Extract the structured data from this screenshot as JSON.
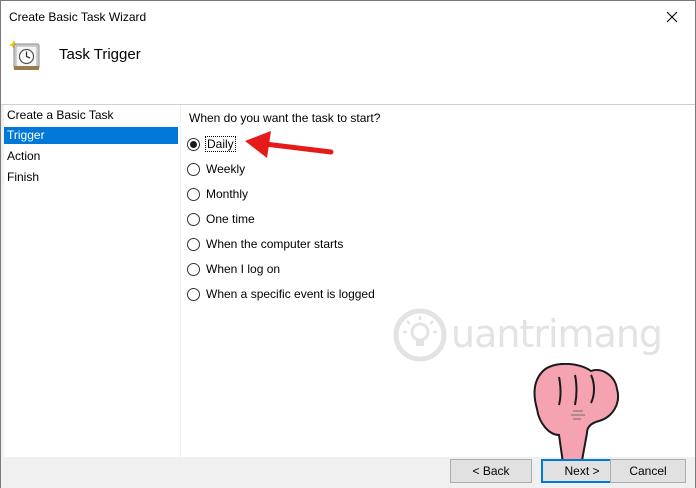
{
  "window": {
    "title": "Create Basic Task Wizard"
  },
  "header": {
    "title": "Task Trigger",
    "icon": "task-scheduler-clock-icon"
  },
  "sidebar": {
    "items": [
      {
        "label": "Create a Basic Task",
        "active": false
      },
      {
        "label": "Trigger",
        "active": true
      },
      {
        "label": "Action",
        "active": false
      },
      {
        "label": "Finish",
        "active": false
      }
    ]
  },
  "main": {
    "question": "When do you want the task to start?",
    "options": [
      {
        "label": "Daily",
        "selected": true
      },
      {
        "label": "Weekly",
        "selected": false
      },
      {
        "label": "Monthly",
        "selected": false
      },
      {
        "label": "One time",
        "selected": false
      },
      {
        "label": "When the computer starts",
        "selected": false
      },
      {
        "label": "When I log on",
        "selected": false
      },
      {
        "label": "When a specific event is logged",
        "selected": false
      }
    ]
  },
  "buttons": {
    "back": "< Back",
    "next": "Next >",
    "cancel": "Cancel"
  },
  "watermark": {
    "text": "uantrimang"
  },
  "colors": {
    "accent": "#0078d7",
    "annotation": "#e51b1b",
    "hand": "#f5a3b0"
  }
}
